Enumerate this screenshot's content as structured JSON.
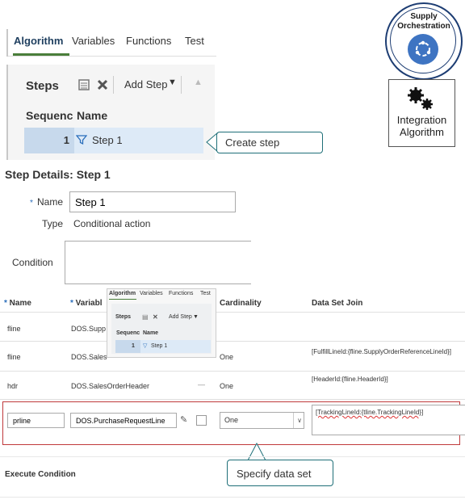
{
  "tabs": [
    "Algorithm",
    "Variables",
    "Functions",
    "Test"
  ],
  "steps_panel": {
    "title": "Steps",
    "add_step": "Add Step",
    "col_sequence": "Sequenc",
    "col_name": "Name",
    "row": {
      "seq": "1",
      "name": "Step 1"
    }
  },
  "callouts": {
    "create_step": "Create step",
    "specify_data_set": "Specify data set"
  },
  "badges": {
    "supply": "Supply Orchestration",
    "integration": "Integration Algorithm"
  },
  "step_details": {
    "title": "Step Details: Step 1",
    "name_label": "Name",
    "name_value": "Step 1",
    "type_label": "Type",
    "type_value": "Conditional action",
    "condition_label": "Condition"
  },
  "grid": {
    "headers": {
      "name": "Name",
      "variable": "Variabl",
      "cardinality": "Cardinality",
      "join": "Data Set Join"
    },
    "rows": [
      {
        "name": "fline",
        "variable": "DOS.Supp",
        "cardinality": "",
        "join": ""
      },
      {
        "name": "fline",
        "variable": "DOS.Sales",
        "cardinality": "One",
        "join": "[FulfillLineId:{fline.SupplyOrderReferenceLineId}]"
      },
      {
        "name": "hdr",
        "variable": "DOS.SalesOrderHeader",
        "cardinality": "One",
        "join": "[HeaderId:{fline.HeaderId}]"
      }
    ],
    "edit_row": {
      "name": "prline",
      "variable": "DOS.PurchaseRequestLine",
      "cardinality": "One",
      "join": "[TrackingLineId:{tline.TrackingLineId}]"
    }
  },
  "mini_panel": {
    "tabs": [
      "Algorithm",
      "Variables",
      "Functions",
      "Test"
    ],
    "title": "Steps",
    "add_step": "Add Step",
    "col_sequence": "Sequenc",
    "col_name": "Name",
    "row": {
      "seq": "1",
      "name": "Step 1"
    }
  },
  "execute_condition": "Execute Condition"
}
